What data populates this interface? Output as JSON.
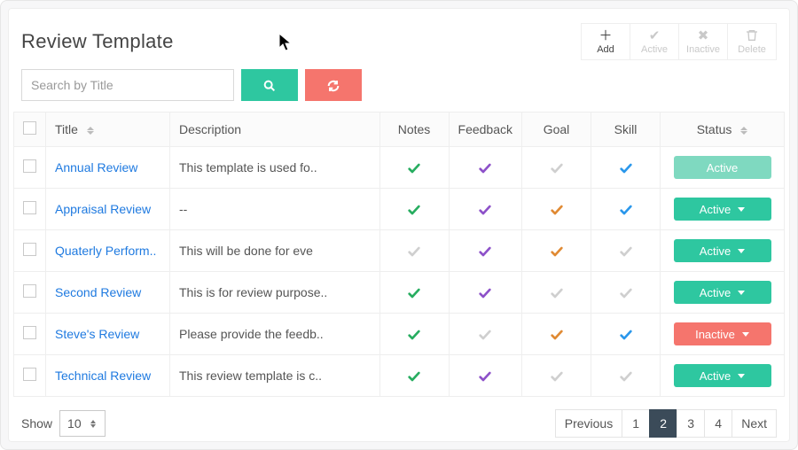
{
  "page": {
    "title": "Review Template"
  },
  "toolbar": {
    "add": {
      "label": "Add",
      "icon": "plus-icon"
    },
    "active": {
      "label": "Active",
      "icon": "check-icon"
    },
    "inactive": {
      "label": "Inactive",
      "icon": "x-icon"
    },
    "delete": {
      "label": "Delete",
      "icon": "trash-icon"
    }
  },
  "search": {
    "placeholder": "Search by Title",
    "value": ""
  },
  "columns": {
    "title": "Title",
    "description": "Description",
    "notes": "Notes",
    "feedback": "Feedback",
    "goal": "Goal",
    "skill": "Skill",
    "status": "Status"
  },
  "rows": [
    {
      "title": "Annual Review",
      "description": "This template is used fo..",
      "notes": "green",
      "feedback": "purple",
      "goal": "grey",
      "skill": "blue",
      "status": "Active",
      "status_style": "muted"
    },
    {
      "title": "Appraisal Review",
      "description": "--",
      "notes": "green",
      "feedback": "purple",
      "goal": "orange",
      "skill": "blue",
      "status": "Active",
      "status_style": "active"
    },
    {
      "title": "Quaterly Perform..",
      "description": "This will be done for eve",
      "notes": "grey",
      "feedback": "purple",
      "goal": "orange",
      "skill": "grey",
      "status": "Active",
      "status_style": "active"
    },
    {
      "title": "Second Review",
      "description": "This is for review purpose..",
      "notes": "green",
      "feedback": "purple",
      "goal": "grey",
      "skill": "grey",
      "status": "Active",
      "status_style": "active"
    },
    {
      "title": "Steve's Review",
      "description": "Please provide the feedb..",
      "notes": "green",
      "feedback": "grey",
      "goal": "orange",
      "skill": "blue",
      "status": "Inactive",
      "status_style": "inactive"
    },
    {
      "title": "Technical Review",
      "description": "This review template is c..",
      "notes": "green",
      "feedback": "purple",
      "goal": "grey",
      "skill": "grey",
      "status": "Active",
      "status_style": "active"
    }
  ],
  "footer": {
    "show_label": "Show",
    "page_size": "10",
    "prev": "Previous",
    "next": "Next",
    "pages": [
      "1",
      "2",
      "3",
      "4"
    ],
    "current_page": "2"
  }
}
